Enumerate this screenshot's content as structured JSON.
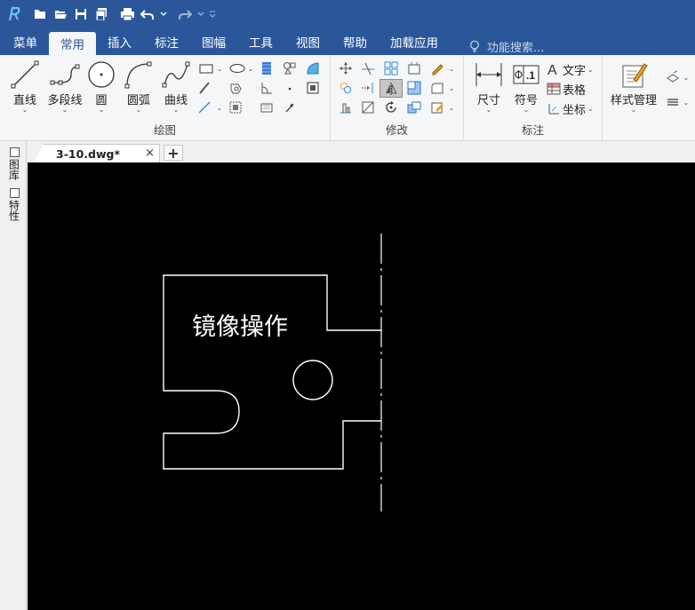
{
  "menu": {
    "tabs": [
      "菜单",
      "常用",
      "插入",
      "标注",
      "图幅",
      "工具",
      "视图",
      "帮助",
      "加载应用"
    ],
    "active_tab": "常用",
    "search_placeholder": "功能搜索..."
  },
  "ribbon": {
    "draw": {
      "label": "绘图",
      "line": "直线",
      "polyline": "多段线",
      "circle": "圆",
      "arc": "圆弧",
      "curve": "曲线"
    },
    "modify": {
      "label": "修改"
    },
    "annotate": {
      "label": "标注",
      "dimension": "尺寸",
      "symbol": "符号",
      "text": "文字",
      "table": "表格",
      "coordinate": "坐标"
    },
    "style": {
      "manager": "样式管理"
    }
  },
  "document": {
    "tab_name": "3-10.dwg*",
    "close_glyph": "×",
    "add_glyph": "+"
  },
  "side_panel": {
    "library": "图库",
    "properties": "特性"
  },
  "drawing": {
    "annotation_text": "镜像操作"
  },
  "colors": {
    "titlebar": "#2b579a",
    "canvas": "#000000",
    "geometry": "#ffffff"
  }
}
